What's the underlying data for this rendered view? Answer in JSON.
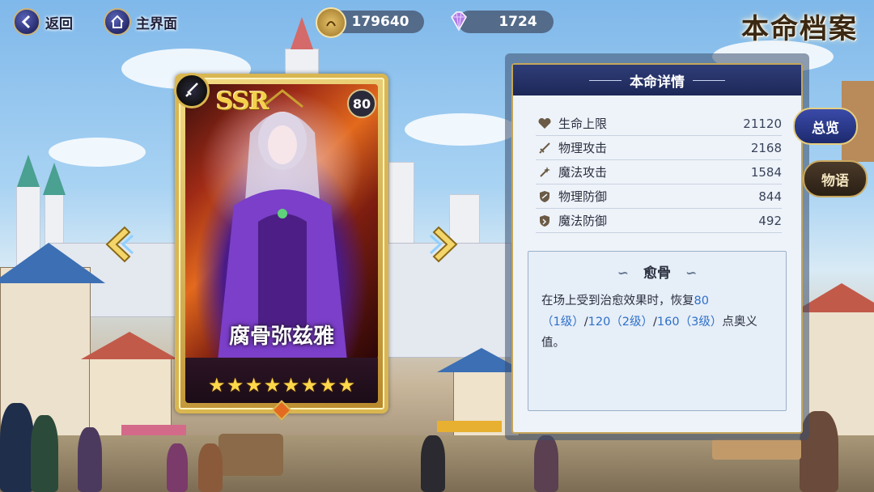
{
  "nav": {
    "back_label": "返回",
    "home_label": "主界面"
  },
  "currency": {
    "gold": "179640",
    "gems": "1724"
  },
  "page_title": "本命档案",
  "card": {
    "rarity": "SSR",
    "level": "80",
    "name": "腐骨弥兹雅",
    "stars": 8
  },
  "panel": {
    "header": "本命详情",
    "stats": [
      {
        "label": "生命上限",
        "value": "21120",
        "icon": "heart-icon"
      },
      {
        "label": "物理攻击",
        "value": "2168",
        "icon": "sword-icon"
      },
      {
        "label": "魔法攻击",
        "value": "1584",
        "icon": "wand-icon"
      },
      {
        "label": "物理防御",
        "value": "844",
        "icon": "shield-icon"
      },
      {
        "label": "魔法防御",
        "value": "492",
        "icon": "magic-shield-icon"
      }
    ],
    "skill": {
      "title": "愈骨",
      "desc_1": "在场上受到治愈效果时，恢复",
      "hl_1": "80",
      "hl_2": "（1级）",
      "sep_1": "/",
      "hl_3": "120（2级）",
      "sep_2": "/",
      "hl_4": "160（3级）",
      "desc_2": "点奥义值。"
    }
  },
  "tabs": {
    "overview": "总览",
    "story": "物语"
  },
  "colors": {
    "accent_gold": "#d9b650",
    "panel_header": "#1d2857",
    "highlight_blue": "#2d6fc8"
  }
}
